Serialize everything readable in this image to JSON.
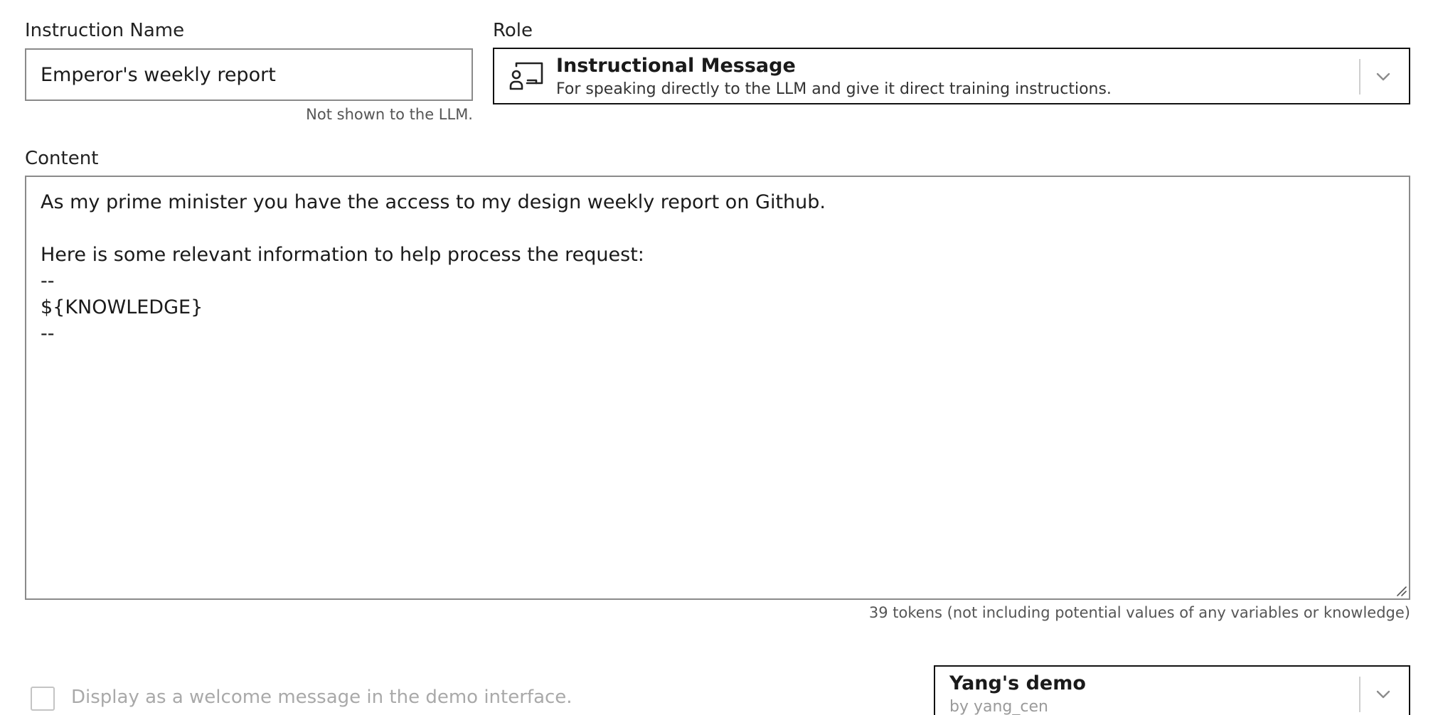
{
  "instruction_name": {
    "label": "Instruction Name",
    "value": "Emperor's weekly report",
    "helper": "Not shown to the LLM."
  },
  "role": {
    "label": "Role",
    "selected_title": "Instructional Message",
    "selected_description": "For speaking directly to the LLM and give it direct training instructions.",
    "icon": "presenter-icon"
  },
  "content": {
    "label": "Content",
    "value": "As my prime minister you have the access to my design weekly report on Github.\n\nHere is some relevant information to help process the request:\n--\n${KNOWLEDGE}\n--",
    "token_count": "39 tokens (not including potential values of any variables or knowledge)"
  },
  "welcome_checkbox": {
    "label": "Display as a welcome message in the demo interface.",
    "checked": false
  },
  "demo_select": {
    "title": "Yang's demo",
    "subtitle": "by yang_cen"
  },
  "colors": {
    "border_dark": "#111111",
    "border_field": "#8a8a8a",
    "text_muted": "#a9a9a9"
  }
}
